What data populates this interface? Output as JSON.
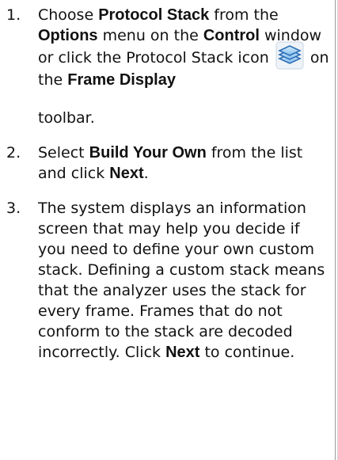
{
  "steps": [
    {
      "num": "1.",
      "parts": [
        {
          "t": "Choose "
        },
        {
          "t": "Protocol Stack",
          "b": true
        },
        {
          "t": " from the "
        },
        {
          "t": "Options",
          "b": true
        },
        {
          "t": " menu on the "
        },
        {
          "t": "Control",
          "b": true
        },
        {
          "t": " window or click the Protocol Stack icon "
        },
        {
          "icon": "protocol-stack-icon"
        },
        {
          "t": " on the "
        },
        {
          "t": "Frame Display",
          "b": true
        },
        {
          "t": "toolbar.",
          "newblock": true
        }
      ]
    },
    {
      "num": "2.",
      "parts": [
        {
          "t": "Select "
        },
        {
          "t": "Build Your Own",
          "b": true
        },
        {
          "t": " from the list and click "
        },
        {
          "t": "Next",
          "b": true
        },
        {
          "t": "."
        }
      ]
    },
    {
      "num": "3.",
      "parts": [
        {
          "t": "The system displays an information screen that may help you decide if you need to define your own custom stack. Defining a custom stack means that the analyzer uses the stack for every frame. Frames that do not conform to the stack are decoded incorrectly.  Click "
        },
        {
          "t": "Next",
          "b": true
        },
        {
          "t": " to continue."
        }
      ]
    }
  ],
  "colors": {
    "icon_blue_light": "#a8d4f5",
    "icon_blue_dark": "#2f6fb5",
    "border": "#9a9a9a"
  }
}
